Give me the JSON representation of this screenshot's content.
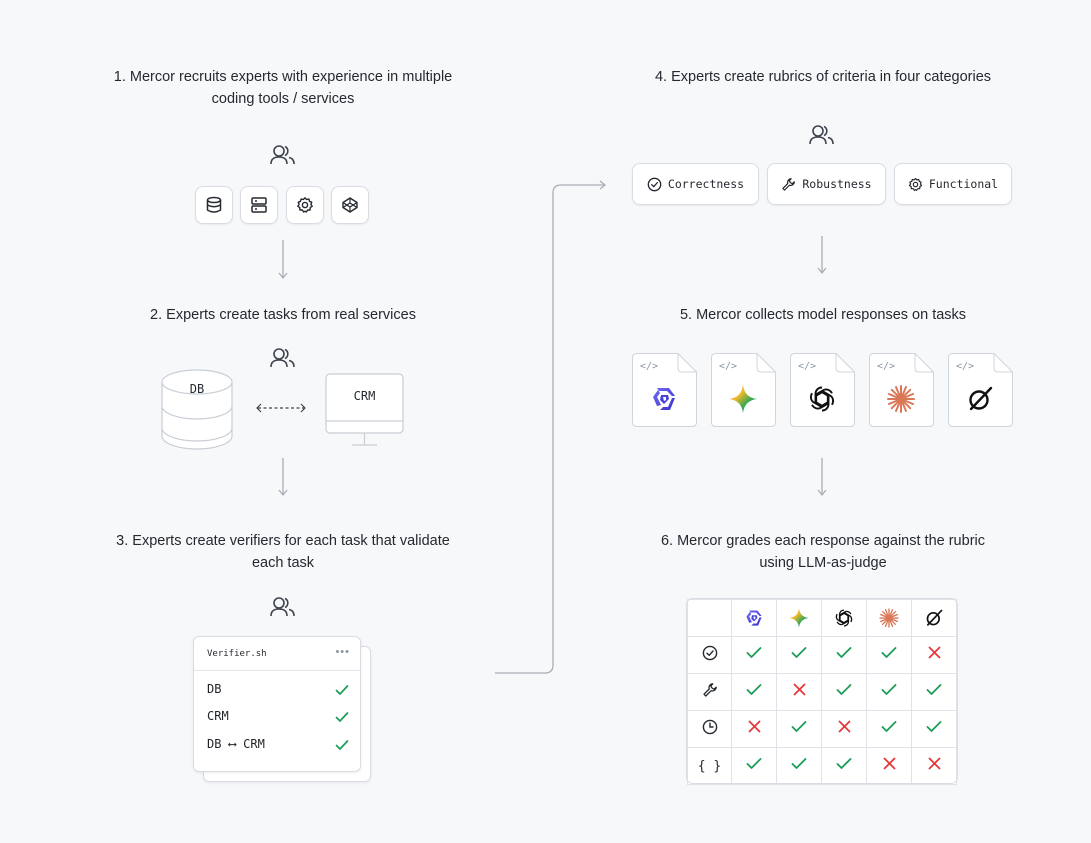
{
  "steps": [
    {
      "title_line1": "1. Mercor recruits experts with experience in multiple",
      "title_line2": "coding tools / services"
    },
    {
      "title_line1": "2. Experts create tasks from real services"
    },
    {
      "title_line1": "3. Experts create verifiers for each task that validate",
      "title_line2": "each task"
    },
    {
      "title_line1": "4. Experts create rubrics of criteria in four categories"
    },
    {
      "title_line1": "5. Mercor collects model responses on tasks"
    },
    {
      "title_line1": "6. Mercor grades each response against the rubric",
      "title_line2": "using LLM-as-judge"
    }
  ],
  "step1_icons": [
    "database-icon",
    "server-icon",
    "gear-icon",
    "codepen-icon"
  ],
  "step2": {
    "db_label": "DB",
    "crm_label": "CRM"
  },
  "step3": {
    "filename": "Verifier.sh",
    "menu": "•••",
    "rows": [
      {
        "label": "DB",
        "status": "pass"
      },
      {
        "label": "CRM",
        "status": "pass"
      },
      {
        "label": "DB ⟷ CRM",
        "status": "pass"
      }
    ]
  },
  "step4": {
    "categories": [
      {
        "label": "Correctness",
        "icon": "check-circle-icon"
      },
      {
        "label": "Robustness",
        "icon": "wrench-icon"
      },
      {
        "label": "Functional",
        "icon": "gear-icon"
      }
    ]
  },
  "step5": {
    "code_tag": "</>",
    "models": [
      "model-a-logo",
      "gemini-logo",
      "openai-logo",
      "claude-logo",
      "grok-logo"
    ]
  },
  "step6": {
    "columns": [
      "model-a-logo",
      "gemini-logo",
      "openai-logo",
      "claude-logo",
      "grok-logo"
    ],
    "rows": [
      {
        "icon": "check-circle-icon",
        "results": [
          "pass",
          "pass",
          "pass",
          "pass",
          "fail"
        ]
      },
      {
        "icon": "wrench-icon",
        "results": [
          "pass",
          "fail",
          "pass",
          "pass",
          "pass"
        ]
      },
      {
        "icon": "clock-icon",
        "results": [
          "fail",
          "pass",
          "fail",
          "pass",
          "pass"
        ]
      },
      {
        "icon": "braces-icon",
        "label": "{ }",
        "results": [
          "pass",
          "pass",
          "pass",
          "fail",
          "fail"
        ]
      }
    ]
  },
  "colors": {
    "pass": "#1a9d57",
    "fail": "#e5383b",
    "icon": "#3d444d",
    "arrow": "#a9afb7"
  }
}
